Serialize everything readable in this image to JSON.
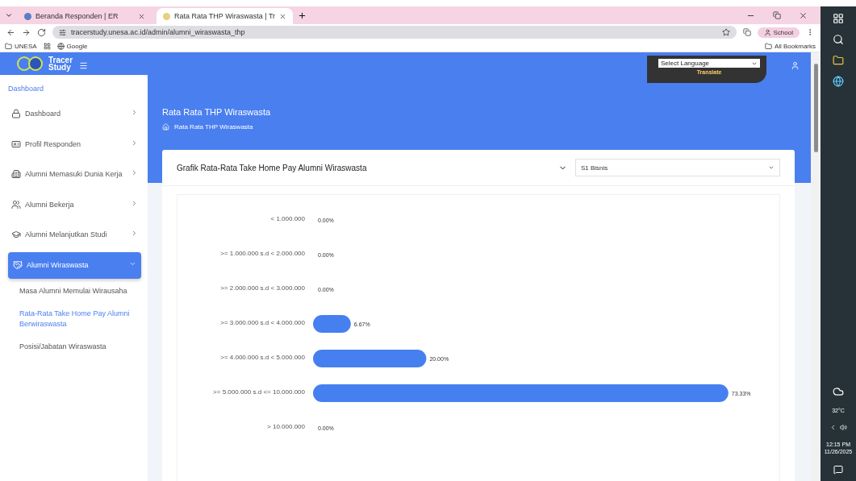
{
  "browser": {
    "tabs": [
      {
        "title": "Beranda Responden | ER",
        "selected": false
      },
      {
        "title": "Rata Rata THP Wiraswasta | Tr",
        "selected": true
      }
    ],
    "url": "tracerstudy.unesa.ac.id/admin/alumni_wiraswasta_thp",
    "bookmarks": [
      "UNESA",
      "Google"
    ],
    "all_bookmarks": "All Bookmarks",
    "profile": "School"
  },
  "header": {
    "logo": [
      "Tracer",
      "Study"
    ],
    "language_select": "Select Language",
    "translate": "Translate"
  },
  "sidebar": {
    "section": "Dashboard",
    "items": [
      {
        "label": "Dashboard",
        "kind": "dashboard",
        "selected": false,
        "expanded": false
      },
      {
        "label": "Profil Responden",
        "kind": "profile",
        "selected": false,
        "expanded": false
      },
      {
        "label": "Alumni Memasuki Dunia Kerja",
        "kind": "work",
        "selected": false,
        "expanded": false
      },
      {
        "label": "Alumni Bekerja",
        "kind": "employed",
        "selected": false,
        "expanded": false
      },
      {
        "label": "Alumni Melanjutkan Studi",
        "kind": "study",
        "selected": false,
        "expanded": false
      },
      {
        "label": "Alumni Wiraswasta",
        "kind": "business",
        "selected": true,
        "expanded": true,
        "children": [
          {
            "label": "Masa Alumni Memulai Wirausaha",
            "selected": false
          },
          {
            "label": "Rata-Rata Take Home Pay Alumni Berwiraswasta",
            "selected": true
          },
          {
            "label": "Posisi/Jabatan Wiraswasta",
            "selected": false
          }
        ]
      }
    ]
  },
  "page": {
    "title": "Rata Rata THP Wiraswasta",
    "breadcrumb": "Rata Rata THP Wiraswasta"
  },
  "card": {
    "title": "Grafik Rata-Rata Take Home Pay Alumni Wiraswasta",
    "program_select": "S1 Bisnis",
    "chart_data": {
      "type": "bar",
      "orientation": "horizontal",
      "categories": [
        "< 1.000.000",
        ">= 1.000.000 s.d < 2.000.000",
        ">= 2.000.000 s.d < 3.000.000",
        ">= 3.000.000 s.d < 4.000.000",
        ">= 4.000.000 s.d < 5.000.000",
        ">= 5.000.000 s.d <= 10.000.000",
        "> 10.000.000"
      ],
      "values": [
        0,
        0,
        0,
        6.67,
        20,
        73.33,
        0
      ],
      "value_labels": [
        "0.00%",
        "0.00%",
        "0.00%",
        "6.67%",
        "20.00%",
        "73.33%",
        "0.00%"
      ]
    }
  },
  "taskbar": {
    "weather": "32°C",
    "time": "12:15 PM",
    "date": "11/26/2025"
  }
}
